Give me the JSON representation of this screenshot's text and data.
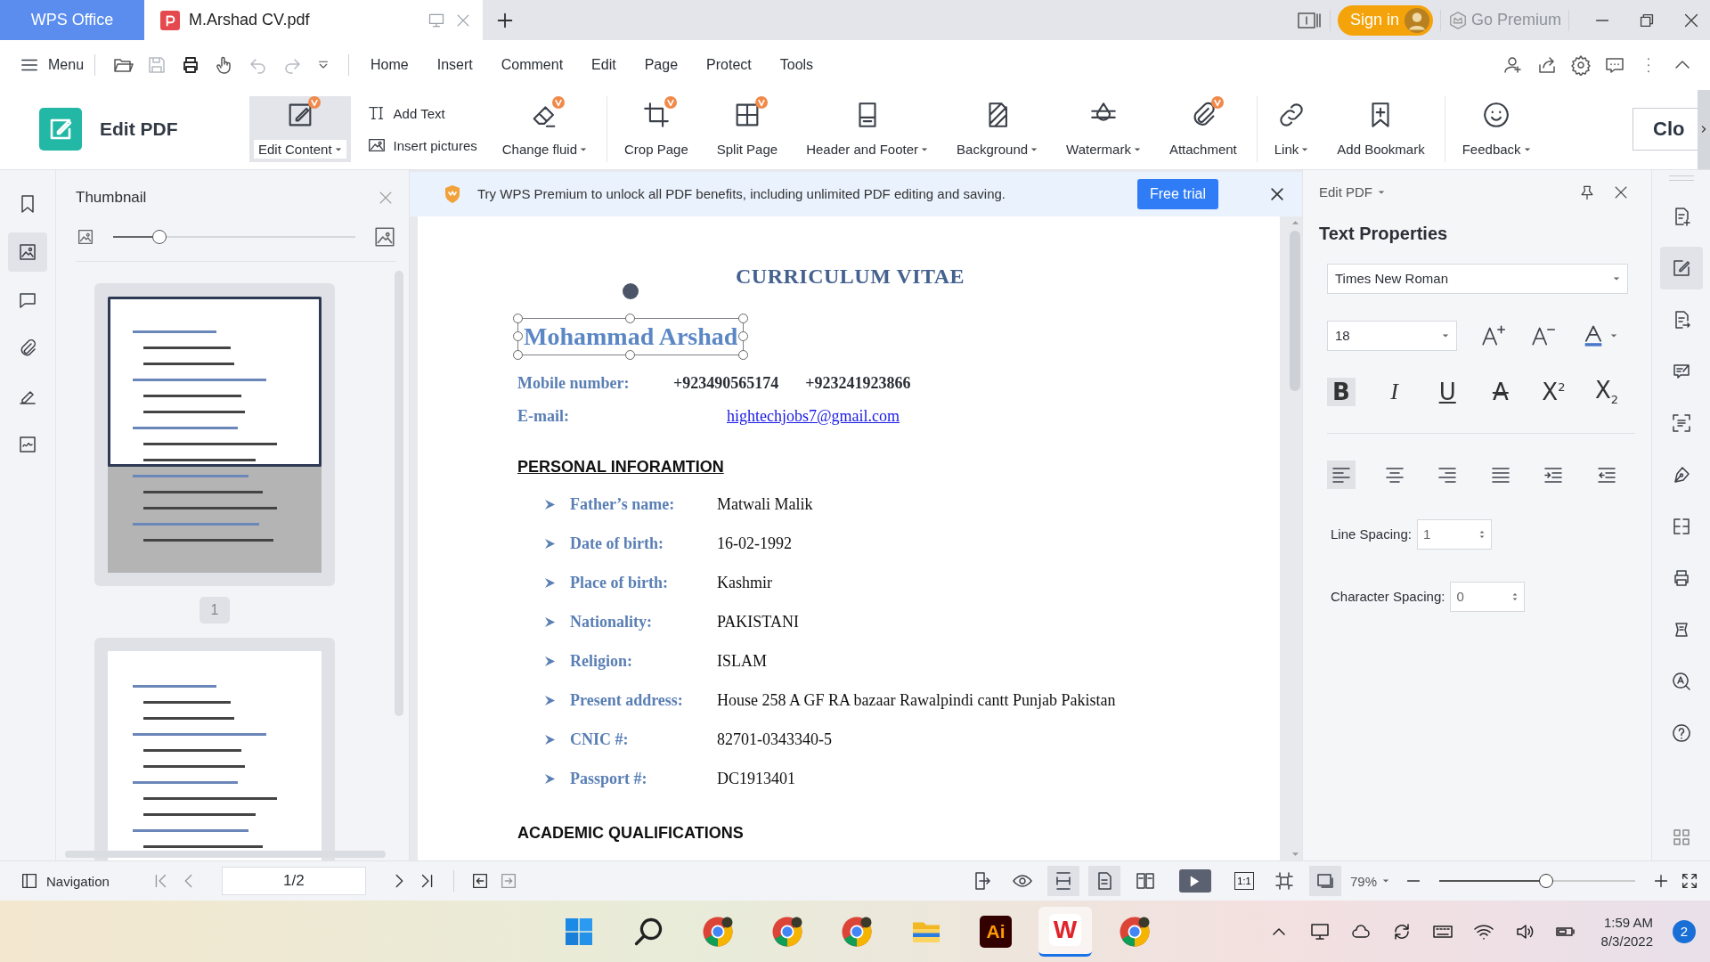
{
  "tabs": [
    {
      "kind": "home",
      "label": "WPS Office",
      "selected": false
    },
    {
      "kind": "doc",
      "label": "M.Arshad CV.pdf",
      "selected": true
    }
  ],
  "title_bar": {
    "sign_in": "Sign in",
    "premium": "Go Premium"
  },
  "menu": {
    "label": "Menu",
    "items": [
      "Home",
      "Insert",
      "Comment",
      "Edit",
      "Page",
      "Protect",
      "Tools"
    ]
  },
  "ribbon": {
    "title": "Edit PDF",
    "close": "Clo",
    "tools": [
      {
        "kind": "edit",
        "label": "Edit Content",
        "dropdown": true,
        "premium": true,
        "selected": true,
        "separated": false
      },
      {
        "kind": "stack",
        "items": [
          {
            "kind": "text",
            "label": "Add Text"
          },
          {
            "kind": "image",
            "label": "Insert pictures"
          }
        ]
      },
      {
        "kind": "eraser",
        "label": "Change fluid",
        "dropdown": true,
        "premium": true,
        "selected": false,
        "separated": false
      },
      {
        "kind": "crop",
        "label": "Crop Page",
        "dropdown": false,
        "premium": true,
        "selected": false,
        "separated": true
      },
      {
        "kind": "split",
        "label": "Split Page",
        "dropdown": false,
        "premium": true,
        "selected": false,
        "separated": false
      },
      {
        "kind": "header",
        "label": "Header and Footer",
        "dropdown": true,
        "premium": false,
        "selected": false,
        "separated": false
      },
      {
        "kind": "background",
        "label": "Background",
        "dropdown": true,
        "premium": false,
        "selected": false,
        "separated": false
      },
      {
        "kind": "watermark",
        "label": "Watermark",
        "dropdown": true,
        "premium": false,
        "selected": false,
        "separated": false
      },
      {
        "kind": "clip",
        "label": "Attachment",
        "dropdown": false,
        "premium": true,
        "selected": false,
        "separated": false
      },
      {
        "kind": "link",
        "label": "Link",
        "dropdown": true,
        "premium": false,
        "selected": false,
        "separated": true
      },
      {
        "kind": "bkplus",
        "label": "Add Bookmark",
        "dropdown": false,
        "premium": false,
        "selected": false,
        "separated": false
      },
      {
        "kind": "smile",
        "label": "Feedback",
        "dropdown": true,
        "premium": false,
        "selected": false,
        "separated": true
      }
    ]
  },
  "left_rail": [
    {
      "kind": "bookmark",
      "selected": false
    },
    {
      "kind": "thumbs",
      "selected": true
    },
    {
      "kind": "comment",
      "selected": false
    },
    {
      "kind": "clip",
      "selected": false
    },
    {
      "kind": "sign",
      "selected": false
    },
    {
      "kind": "imgsig",
      "selected": false
    }
  ],
  "thumbnail_panel": {
    "title": "Thumbnail",
    "slider": {
      "level": 0.17
    },
    "pages": [
      {
        "label": "1",
        "selected": true
      },
      {
        "selected": false
      }
    ]
  },
  "notice": {
    "text": "Try WPS Premium to unlock all PDF benefits, including unlimited PDF editing and saving.",
    "button": "Free trial"
  },
  "document": {
    "title": "CURRICULUM VITAE",
    "name": "Mohammad Arshad",
    "contacts": [
      {
        "kind": "phone",
        "label": "Mobile number:",
        "values": [
          "+923490565174",
          "+923241923866"
        ]
      },
      {
        "kind": "link",
        "label": "E-mail:",
        "values": [
          "hightechjobs7@gmail.com"
        ]
      }
    ],
    "section": "PERSONAL INFORAMTION",
    "rows": [
      {
        "label": "Father’s name:",
        "value": "Matwali  Malik"
      },
      {
        "label": "Date of birth:",
        "value": "16-02-1992"
      },
      {
        "label": "Place of birth:",
        "value": "Kashmir"
      },
      {
        "label": "Nationality:",
        "value": "PAKISTANI"
      },
      {
        "label": "Religion:",
        "value": "ISLAM"
      },
      {
        "label": "Present address:",
        "value": "House 258 A GF RA bazaar Rawalpindi cantt Punjab Pakistan"
      },
      {
        "label": "CNIC #:",
        "value": "82701-0343340-5"
      },
      {
        "label": "Passport #:",
        "value": "DC1913401"
      }
    ],
    "next_section": "ACADEMIC QUALIFICATIONS"
  },
  "properties": {
    "header": "Edit PDF",
    "title": "Text Properties",
    "font": "Times New Roman",
    "size": "18",
    "styles": [
      {
        "kind": "bold",
        "glyph": "B",
        "selected": true
      },
      {
        "kind": "italic",
        "glyph": "I",
        "selected": false
      },
      {
        "kind": "underline",
        "glyph": "U",
        "selected": false
      },
      {
        "kind": "strike",
        "glyph": "A",
        "selected": false
      },
      {
        "kind": "sup",
        "glyph": "X$^{2}$",
        "selected": false
      },
      {
        "kind": "sub",
        "glyph": "X$_{2}$",
        "selected": false
      }
    ],
    "alignments": [
      {
        "kind": "left",
        "selected": true
      },
      {
        "kind": "center",
        "selected": false
      },
      {
        "kind": "right",
        "selected": false
      },
      {
        "kind": "justify",
        "selected": false
      },
      {
        "kind": "indent",
        "selected": false
      },
      {
        "kind": "outdent",
        "selected": false
      }
    ],
    "spacings": [
      {
        "label": "Line Spacing:",
        "value": "1"
      },
      {
        "label": "Character Spacing:",
        "value": "0"
      }
    ]
  },
  "right_rail": [
    {
      "kind": "docplus",
      "selected": false
    },
    {
      "kind": "editbox",
      "selected": true
    },
    {
      "kind": "docarrow",
      "selected": false
    },
    {
      "kind": "review",
      "selected": false
    },
    {
      "kind": "scan",
      "selected": false
    },
    {
      "kind": "pen",
      "selected": false
    },
    {
      "kind": "compare",
      "selected": false
    },
    {
      "kind": "print",
      "selected": false
    },
    {
      "kind": "scroll",
      "selected": false
    },
    {
      "kind": "finda",
      "selected": false
    },
    {
      "kind": "help",
      "selected": false
    }
  ],
  "status_bar": {
    "navigation": "Navigation",
    "page": "1/2",
    "zoom": "79%",
    "zoom_slider": {
      "level": 0.55
    },
    "views": [
      {
        "kind": "export",
        "selected": false
      },
      {
        "kind": "eye",
        "selected": false
      },
      {
        "kind": "fitw",
        "selected": true
      },
      {
        "kind": "single",
        "selected": true
      },
      {
        "kind": "two",
        "selected": false
      },
      {
        "kind": "play",
        "selected": false
      },
      {
        "kind": "ratio",
        "label": "1:1",
        "selected": false
      },
      {
        "kind": "fitpage",
        "selected": false
      },
      {
        "kind": "fitrect",
        "selected": true
      }
    ]
  },
  "taskbar": {
    "apps": [
      {
        "kind": "start",
        "selected": false
      },
      {
        "kind": "search",
        "selected": false
      },
      {
        "kind": "chrome",
        "selected": false
      },
      {
        "kind": "chrome",
        "selected": false
      },
      {
        "kind": "chrome",
        "selected": false
      },
      {
        "kind": "files",
        "selected": false
      },
      {
        "kind": "illustrator",
        "label": "Ai",
        "selected": false
      },
      {
        "kind": "wps",
        "label": "W",
        "selected": true
      },
      {
        "kind": "chrome",
        "selected": false
      }
    ],
    "time": "1:59 AM",
    "date": "8/3/2022",
    "notifications": "2"
  }
}
